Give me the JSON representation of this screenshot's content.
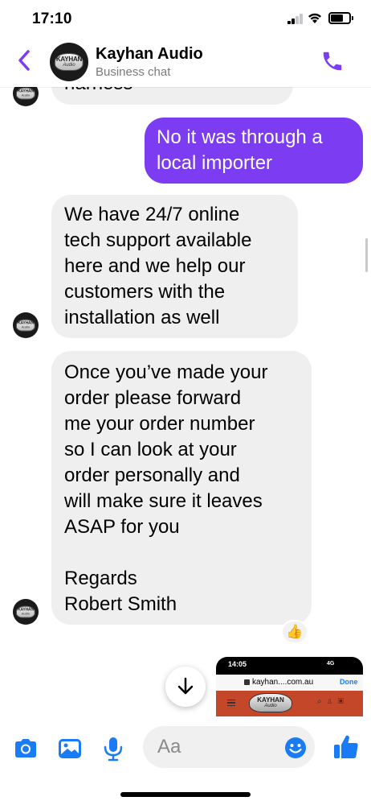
{
  "status_bar": {
    "time": "17:10"
  },
  "header": {
    "title": "Kayhan Audio",
    "subtitle": "Business chat",
    "logo_line1": "KAYHAN",
    "logo_line2": "Audio"
  },
  "messages": [
    {
      "sender": "business",
      "lines": [
        "harness"
      ]
    },
    {
      "sender": "user",
      "lines": [
        "No it was through a",
        "local importer"
      ]
    },
    {
      "sender": "business",
      "lines": [
        "We have 24/7 online",
        "tech support available",
        "here and we help our",
        "customers with the",
        "installation as well"
      ]
    },
    {
      "sender": "business",
      "lines": [
        "Once you’ve made your",
        "order please forward",
        "me your order number",
        "so I can look at your",
        "order personally and",
        "will make sure it leaves",
        "ASAP for you",
        "",
        "Regards",
        "Robert Smith"
      ],
      "reaction": "👍"
    }
  ],
  "attachment_preview": {
    "time": "14:05",
    "signal": "4G",
    "url": "kayhan....com.au",
    "done_label": "Done",
    "logo_line1": "KAYHAN",
    "logo_line2": "Audio"
  },
  "composer": {
    "placeholder": "Aa"
  },
  "colors": {
    "accent": "#7b3cf2",
    "incoming_bubble": "#efefef",
    "toolbar_blue": "#1a7cf5"
  },
  "icons": [
    "back-icon",
    "phone-icon",
    "camera-icon",
    "gallery-icon",
    "microphone-icon",
    "emoji-icon",
    "thumbs-up-icon",
    "scroll-down-icon"
  ]
}
